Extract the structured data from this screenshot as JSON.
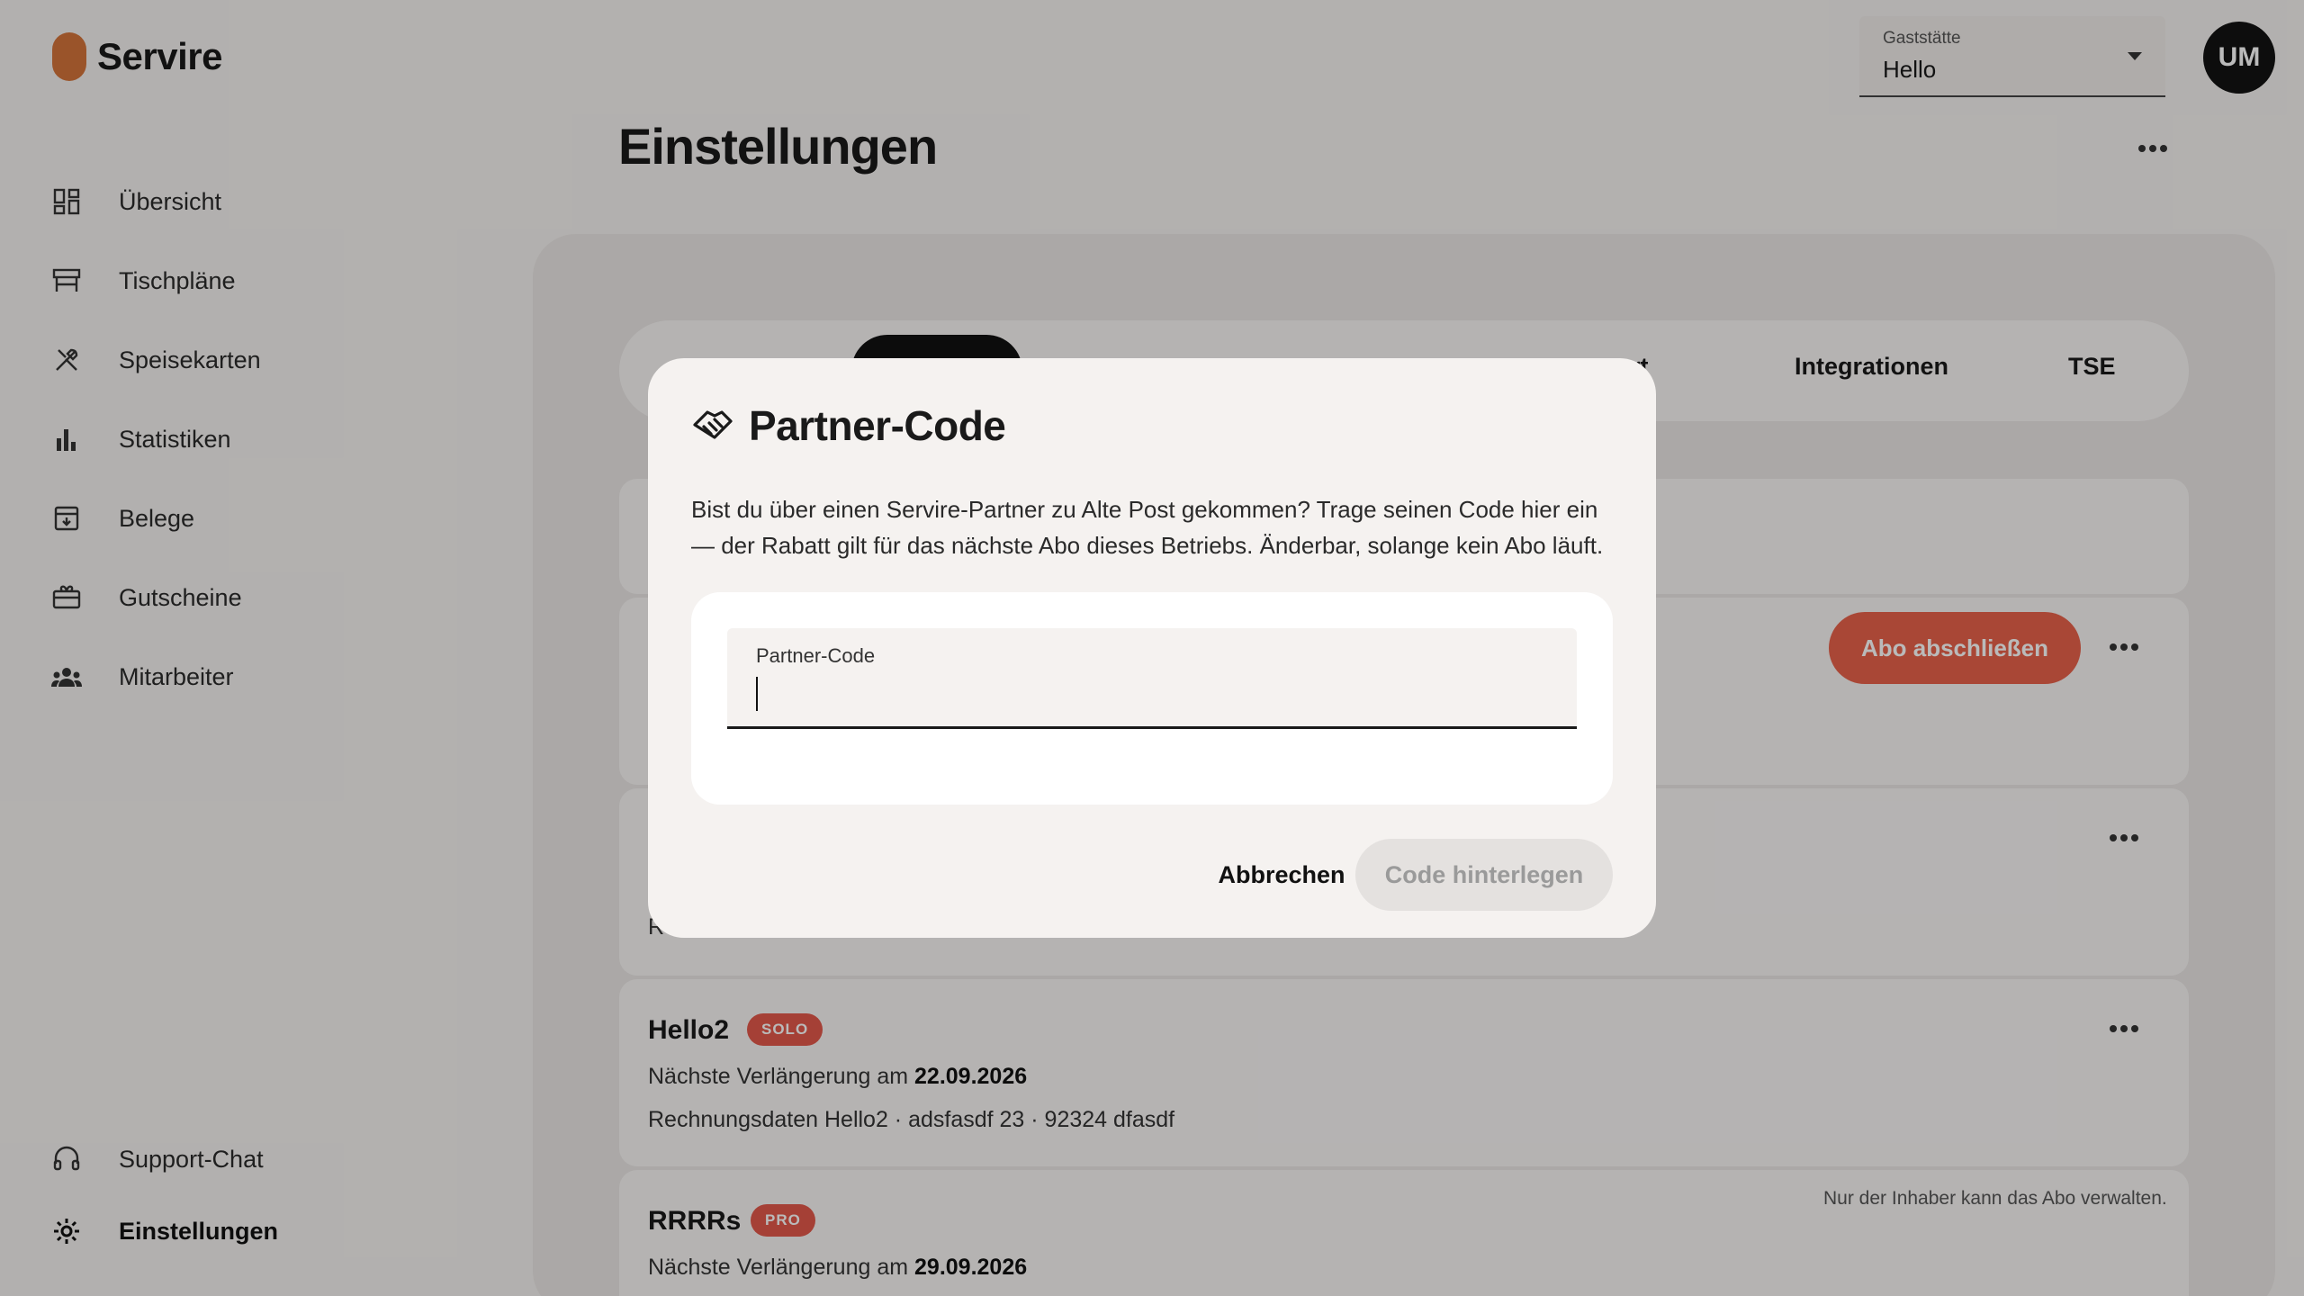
{
  "brand": {
    "name": "Servire",
    "accent": "#d3733a"
  },
  "sidebar": {
    "items": [
      {
        "label": "Übersicht",
        "icon": "dashboard-icon"
      },
      {
        "label": "Tischpläne",
        "icon": "table-icon"
      },
      {
        "label": "Speisekarten",
        "icon": "cutlery-icon"
      },
      {
        "label": "Statistiken",
        "icon": "bar-chart-icon"
      },
      {
        "label": "Belege",
        "icon": "receipt-icon"
      },
      {
        "label": "Gutscheine",
        "icon": "gift-card-icon"
      },
      {
        "label": "Mitarbeiter",
        "icon": "people-icon"
      }
    ],
    "bottom": [
      {
        "label": "Support-Chat",
        "icon": "headset-icon"
      },
      {
        "label": "Einstellungen",
        "icon": "gear-icon",
        "active": true
      }
    ]
  },
  "header": {
    "venue_select": {
      "label": "Gaststätte",
      "value": "Hello"
    },
    "avatar_initials": "UM"
  },
  "page": {
    "title": "Einstellungen"
  },
  "tabs": {
    "partial_label": "rt",
    "integrations": "Integrationen",
    "tse": "TSE"
  },
  "background": {
    "subscribe_label": "Abo abschließen",
    "rows": [
      {
        "name": "Hello2",
        "badge": "SOLO",
        "renewal_prefix": "Nächste Verlängerung am",
        "renewal_date": "22.09.2026",
        "billing": "Rechnungsdaten Hello2 · adsfasdf 23 · 92324 dfasdf"
      },
      {
        "name": "RRRRs",
        "badge": "PRO",
        "renewal_prefix": "Nächste Verlängerung am",
        "renewal_date": "29.09.2026"
      }
    ],
    "partial_text": "Re",
    "owner_note": "Nur der Inhaber kann das Abo verwalten.",
    "badge_color": "#e2584a",
    "button_color": "#e8624a"
  },
  "modal": {
    "title": "Partner-Code",
    "icon": "handshake-icon",
    "description": "Bist du über einen Servire-Partner zu Alte Post gekommen? Trage seinen Code hier ein — der Rabatt gilt für das nächste Abo dieses Betriebs. Änderbar, solange kein Abo läuft.",
    "field_label": "Partner-Code",
    "field_value": "",
    "cancel_label": "Abbrechen",
    "submit_label": "Code hinterlegen"
  }
}
